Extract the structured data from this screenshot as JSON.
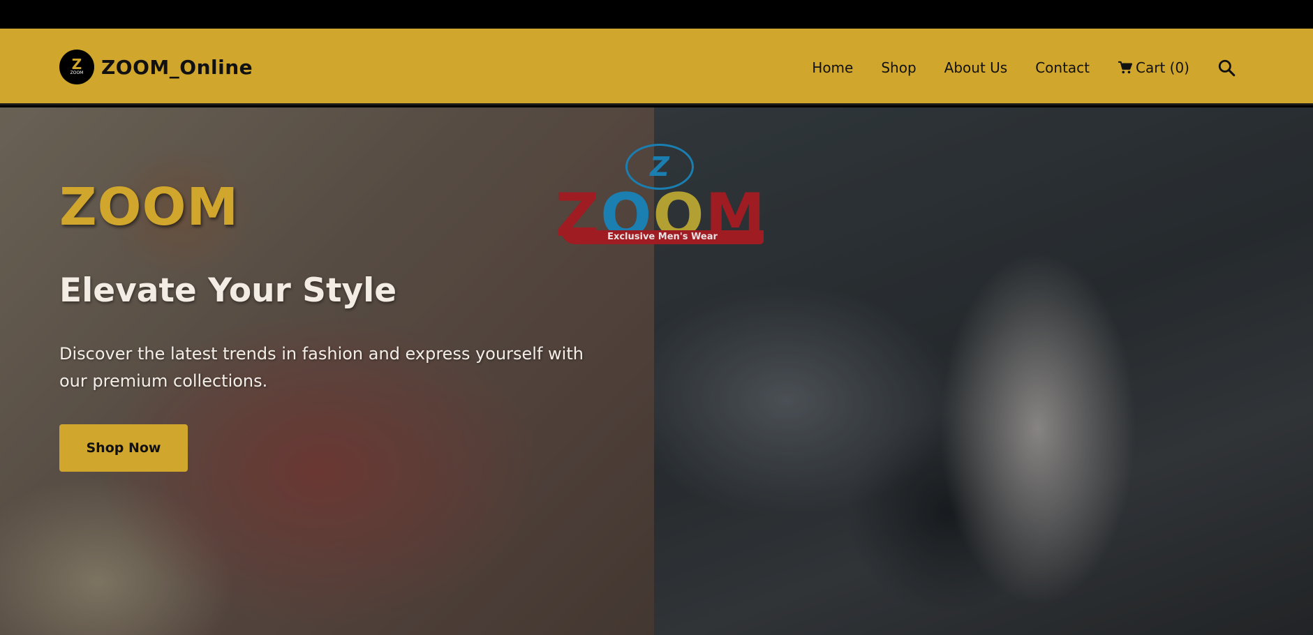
{
  "brand": {
    "name": "ZOOM_Online",
    "logo_letter": "Z",
    "logo_small": "ZOOM"
  },
  "nav": {
    "items": [
      {
        "label": "Home"
      },
      {
        "label": "Shop"
      },
      {
        "label": "About Us"
      },
      {
        "label": "Contact"
      }
    ],
    "cart_label": "Cart (0)",
    "cart_icon": "cart-icon",
    "search_icon": "search-icon"
  },
  "hero": {
    "brand": "ZOOM",
    "title": "Elevate Your Style",
    "description": "Discover the latest trends in fashion and express yourself with our premium collections.",
    "cta_label": "Shop Now"
  },
  "center_logo": {
    "emblem_letter": "Z",
    "wordmark": [
      "Z",
      "O",
      "O",
      "M"
    ],
    "tagline": "Exclusive Men's Wear"
  },
  "colors": {
    "accent": "#d1a62c",
    "logo_red": "#9e1c22",
    "logo_blue": "#1b7fb2",
    "logo_yellow": "#b2a032"
  }
}
